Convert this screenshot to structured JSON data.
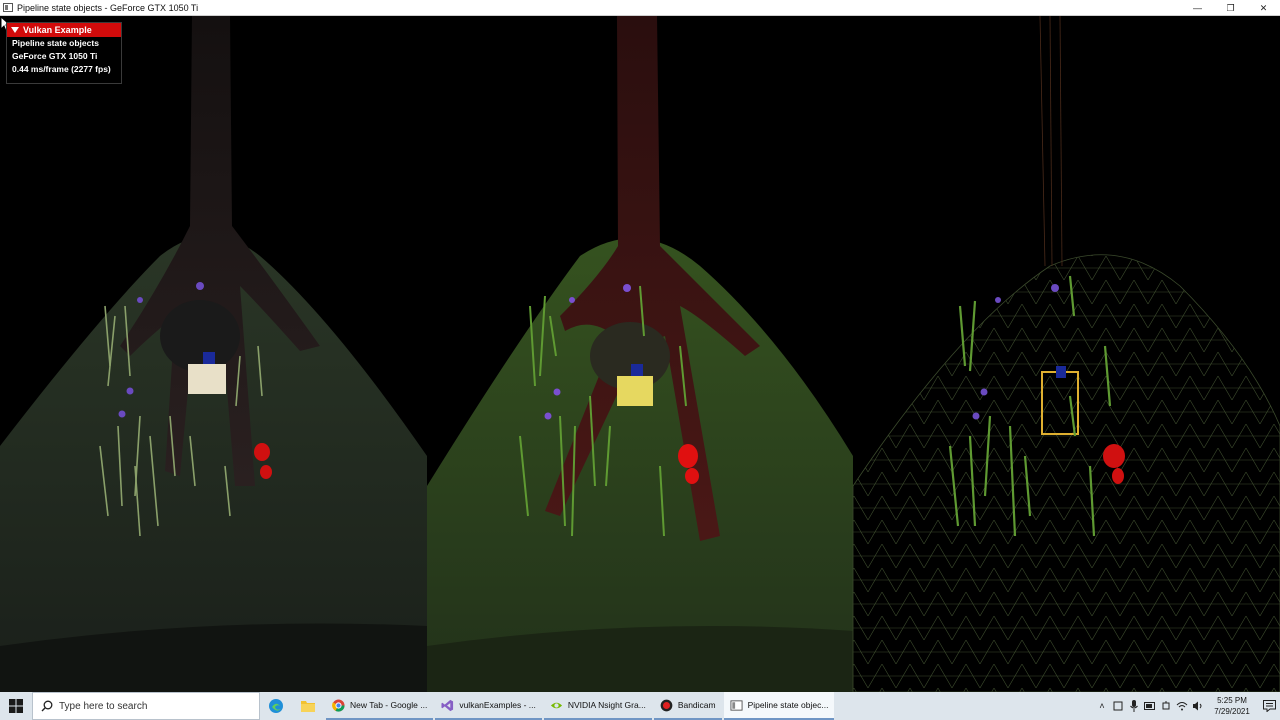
{
  "window": {
    "title": "Pipeline state objects - GeForce GTX 1050 Ti",
    "minimize_glyph": "—",
    "maximize_glyph": "❐",
    "close_glyph": "✕"
  },
  "overlay": {
    "header": "Vulkan Example",
    "lines": [
      "Pipeline state objects",
      "GeForce GTX 1050 Ti",
      "0.44 ms/frame (2277 fps)"
    ]
  },
  "taskbar": {
    "search_placeholder": "Type here to search",
    "tasks": [
      {
        "label": "New Tab - Google ...",
        "icon": "chrome-icon"
      },
      {
        "label": "vulkanExamples - ...",
        "icon": "visual-studio-icon"
      },
      {
        "label": "NVIDIA Nsight Gra...",
        "icon": "nvidia-icon"
      },
      {
        "label": "Bandicam",
        "icon": "bandicam-icon"
      },
      {
        "label": "Pipeline state objec...",
        "icon": "app-window-icon"
      }
    ],
    "clock": {
      "time": "5:25 PM",
      "date": "7/29/2021"
    }
  },
  "colors": {
    "imgui_header": "#d10b0b",
    "taskbar_bg": "#dde5ec",
    "grass": "#6f9a4a",
    "mushroom_red": "#e01010",
    "mushroom_purple": "#7a4fd0"
  }
}
